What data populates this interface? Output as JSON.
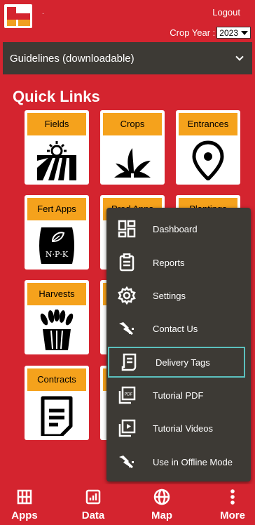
{
  "header": {
    "dot": ".",
    "logout": "Logout",
    "crop_year_label": "Crop Year :",
    "crop_year_value": "2023"
  },
  "guidelines": {
    "label": "Guidelines (downloadable)"
  },
  "quick_links": {
    "title": "Quick Links",
    "tiles": [
      {
        "label": "Fields",
        "icon": "field-icon"
      },
      {
        "label": "Crops",
        "icon": "crop-sprout-icon"
      },
      {
        "label": "Entrances",
        "icon": "location-pin-icon"
      },
      {
        "label": "Fert Apps",
        "icon": "fertilizer-bag-icon"
      },
      {
        "label": "Prod Apps",
        "icon": "product-icon"
      },
      {
        "label": "Plantings",
        "icon": "planting-icon"
      },
      {
        "label": "Harvests",
        "icon": "wheat-basket-icon"
      },
      {
        "label": "",
        "icon": "unknown-icon"
      },
      {
        "label": "Contracts",
        "icon": "document-icon"
      },
      {
        "label": "",
        "icon": "unknown-icon"
      }
    ],
    "npk_text": "N·P·K"
  },
  "menu": {
    "items": [
      {
        "label": "Dashboard",
        "icon": "dashboard-icon"
      },
      {
        "label": "Reports",
        "icon": "clipboard-icon"
      },
      {
        "label": "Settings",
        "icon": "gear-icon"
      },
      {
        "label": "Contact Us",
        "icon": "handshake-icon"
      },
      {
        "label": "Delivery Tags",
        "icon": "receipt-icon",
        "selected": true
      },
      {
        "label": "Tutorial PDF",
        "icon": "pdf-icon"
      },
      {
        "label": "Tutorial Videos",
        "icon": "video-library-icon"
      },
      {
        "label": "Use in Offline Mode",
        "icon": "handshake-icon"
      }
    ],
    "highlight_color": "#5bc0be"
  },
  "bottom_nav": {
    "items": [
      {
        "label": "Apps",
        "icon": "grid-icon"
      },
      {
        "label": "Data",
        "icon": "chart-icon"
      },
      {
        "label": "Map",
        "icon": "globe-icon"
      },
      {
        "label": "More",
        "icon": "more-vertical-icon"
      }
    ]
  },
  "colors": {
    "brand_red": "#d4242f",
    "tile_orange": "#f5a21c",
    "menu_bg": "#3d3a35"
  }
}
